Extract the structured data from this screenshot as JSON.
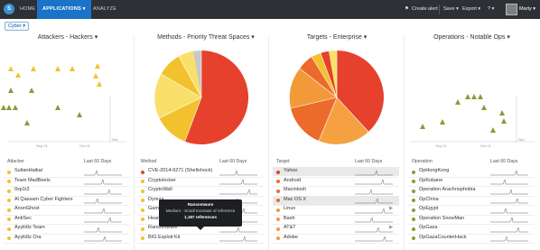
{
  "nav": {
    "logo_glyph": "S",
    "home": "HOME",
    "applications": "APPLICATIONS ▾",
    "analyze": "ANALYZE",
    "create_alert": "Create alert",
    "save": "Save ▾",
    "export": "Export ▾",
    "help": "? ▾",
    "user": "Marty ▾"
  },
  "filter": {
    "label": "Cyber ▾"
  },
  "panels": [
    {
      "title": "Attackers - Hackers ▾"
    },
    {
      "title": "Methods - Priority Threat Spaces ▾"
    },
    {
      "title": "Targets - Enterprise ▾"
    },
    {
      "title": "Operations - Notable Ops ▾"
    }
  ],
  "timeline_ticks": {
    "t1": "Sep 01",
    "t2": "Oct 01",
    "t3": "Nov"
  },
  "tables": [
    {
      "col1": "Attacker",
      "col2": "Last 60 Days",
      "rows": [
        {
          "label": "SultanHaikal",
          "color": "#f2c12e"
        },
        {
          "label": "Team MadBeets",
          "color": "#f2c12e"
        },
        {
          "label": "0xp1t3",
          "color": "#f2c12e"
        },
        {
          "label": "Al Qassam Cyber Fighters",
          "color": "#f2c12e"
        },
        {
          "label": "AnonGhost",
          "color": "#f2c12e"
        },
        {
          "label": "AntiSec",
          "color": "#f2c12e"
        },
        {
          "label": "AyyildIz Team",
          "color": "#f2c12e"
        },
        {
          "label": "AyyildIz Ora",
          "color": "#f2c12e"
        }
      ]
    },
    {
      "col1": "Method",
      "col2": "Last 60 Days",
      "rows": [
        {
          "label": "CVE-2014-6271 (Shellshock)",
          "color": "#e5412d"
        },
        {
          "label": "Cryptolocker",
          "color": "#f2c12e"
        },
        {
          "label": "CryptoWall",
          "color": "#f2c12e"
        },
        {
          "label": "Dyreza",
          "color": "#f2c12e"
        },
        {
          "label": "Gameover",
          "color": "#f2c12e"
        },
        {
          "label": "Heartbleed",
          "color": "#f2c12e"
        },
        {
          "label": "Ransomware",
          "color": "#f2c12e"
        },
        {
          "label": "BIG Exploit Kit",
          "color": "#f2c12e"
        }
      ]
    },
    {
      "col1": "Target",
      "col2": "Last 60 Days",
      "rows": [
        {
          "label": "Yahoo",
          "color": "#e5412d"
        },
        {
          "label": "Android",
          "color": "#ec6a2a"
        },
        {
          "label": "Macintosh",
          "color": "#ec6a2a"
        },
        {
          "label": "Mac OS X",
          "color": "#ec6a2a"
        },
        {
          "label": "Linux",
          "color": "#f29a3a"
        },
        {
          "label": "Bash",
          "color": "#f29a3a"
        },
        {
          "label": "AT&T",
          "color": "#f29a3a"
        },
        {
          "label": "Adobe",
          "color": "#f29a3a"
        }
      ]
    },
    {
      "col1": "Operation",
      "col2": "Last 60 Days",
      "rows": [
        {
          "label": "OpHongKong",
          "color": "#8a9a3c"
        },
        {
          "label": "OpKobane",
          "color": "#8a9a3c"
        },
        {
          "label": "Operation Arachnophobia",
          "color": "#8a9a3c"
        },
        {
          "label": "OpChina",
          "color": "#8a9a3c"
        },
        {
          "label": "OpEgypt",
          "color": "#8a9a3c"
        },
        {
          "label": "Operation SnowMan",
          "color": "#8a9a3c"
        },
        {
          "label": "OpGaza",
          "color": "#8a9a3c"
        },
        {
          "label": "OpGazaCounterHack",
          "color": "#8a9a3c"
        }
      ]
    }
  ],
  "tooltip": {
    "title": "Ransomware",
    "subtitle": "Medium - Small Increase of reference",
    "count": "1,187 references"
  },
  "colors": {
    "accent": "#1b73c8",
    "red": "#e5412d",
    "orange": "#ec6a2a",
    "light_orange": "#f29a3a",
    "yellow": "#f2c12e",
    "pale_yellow": "#f8e06a",
    "olive": "#8a9a3c"
  }
}
